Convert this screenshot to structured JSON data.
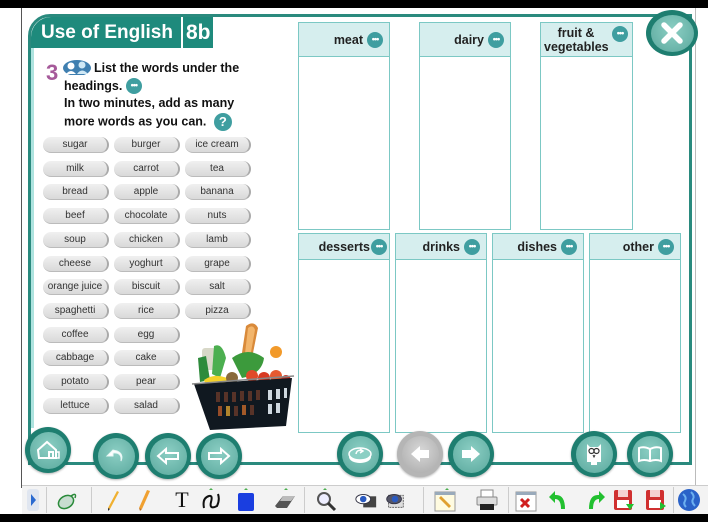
{
  "header": {
    "title": "Use of English",
    "unit": "8b"
  },
  "exercise": {
    "number": "3",
    "instruction_line1": "List the words under the",
    "instruction_line2": "headings.",
    "instruction_line3": "In two minutes, add as many",
    "instruction_line4": "more words as you can.",
    "help_icon": "?",
    "more_icon": "•••"
  },
  "words": [
    "sugar",
    "burger",
    "ice cream",
    "milk",
    "carrot",
    "tea",
    "bread",
    "apple",
    "banana",
    "beef",
    "chocolate",
    "nuts",
    "soup",
    "chicken",
    "lamb",
    "cheese",
    "yoghurt",
    "grape",
    "orange juice",
    "biscuit",
    "salt",
    "spaghetti",
    "rice",
    "pizza",
    "coffee",
    "egg",
    "cabbage",
    "cake",
    "potato",
    "pear",
    "lettuce",
    "salad"
  ],
  "categories": [
    {
      "label": "meat"
    },
    {
      "label": "dairy"
    },
    {
      "label": "fruit & vegetables"
    },
    {
      "label": "desserts"
    },
    {
      "label": "drinks"
    },
    {
      "label": "dishes"
    },
    {
      "label": "other"
    }
  ],
  "nav_buttons": {
    "home": "home-icon",
    "back": "undo-icon",
    "prev": "arrow-left-icon",
    "next": "arrow-right-icon",
    "reset": "reset-icon",
    "page_prev": "arrow-left-icon",
    "page_next": "arrow-right-icon",
    "owl": "owl-icon",
    "book": "book-icon",
    "close": "close-icon"
  },
  "colors": {
    "accent": "#1e8a7c",
    "box_border": "#7cc8c4",
    "box_header": "#d6eeee",
    "exercise_number": "#a65a9a"
  },
  "toolbar": {
    "text_tool": "T"
  }
}
